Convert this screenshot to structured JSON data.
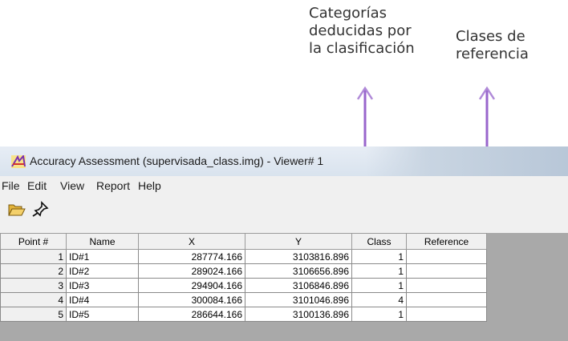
{
  "annotations": {
    "left_label": [
      "Categorías",
      "deducidas por",
      "la clasificación"
    ],
    "right_label": [
      "Clases de",
      "referencia"
    ],
    "arrow_color": "#9966cc"
  },
  "window": {
    "title": "Accuracy Assessment (supervisada_class.img) - Viewer# 1",
    "menu": [
      "File",
      "Edit",
      "View",
      "Report",
      "Help"
    ],
    "toolbar_icons": [
      "open-folder-icon",
      "pin-icon"
    ]
  },
  "table": {
    "columns": [
      "Point #",
      "Name",
      "X",
      "Y",
      "Class",
      "Reference"
    ],
    "rows": [
      {
        "point": "1",
        "name": "ID#1",
        "x": "287774.166",
        "y": "3103816.896",
        "class": "1",
        "reference": ""
      },
      {
        "point": "2",
        "name": "ID#2",
        "x": "289024.166",
        "y": "3106656.896",
        "class": "1",
        "reference": ""
      },
      {
        "point": "3",
        "name": "ID#3",
        "x": "294904.166",
        "y": "3106846.896",
        "class": "1",
        "reference": ""
      },
      {
        "point": "4",
        "name": "ID#4",
        "x": "300084.166",
        "y": "3101046.896",
        "class": "4",
        "reference": ""
      },
      {
        "point": "5",
        "name": "ID#5",
        "x": "286644.166",
        "y": "3100136.896",
        "class": "1",
        "reference": ""
      }
    ]
  }
}
